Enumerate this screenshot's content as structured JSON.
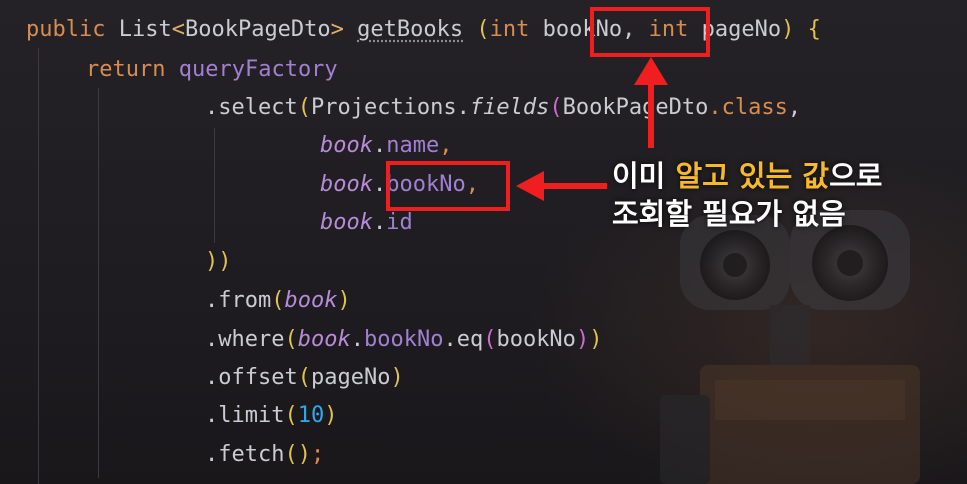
{
  "code": {
    "line1": {
      "kw_public": "public",
      "type_list": "List",
      "lt": "<",
      "generic": "BookPageDto",
      "gt": ">",
      "method": "getBooks",
      "open": "(",
      "int1": "int",
      "param1": "bookNo,",
      "int2": "int",
      "param2": "pageNo",
      "close": ")",
      "brace": "{"
    },
    "line2": {
      "kw_return": "return",
      "factory": "queryFactory"
    },
    "line3": {
      "select": ".select",
      "open1": "(",
      "projections": "Projections",
      "dot": ".",
      "fields": "fields",
      "open2": "(",
      "cls": "BookPageDto",
      "dotclass": ".class",
      "comma": ","
    },
    "line4": {
      "obj": "book",
      "dot": ".",
      "field": "name",
      "comma": ","
    },
    "line5": {
      "obj": "book",
      "dot": ".",
      "field": "bookNo",
      "comma": ","
    },
    "line6": {
      "obj": "book",
      "dot": ".",
      "field": "id"
    },
    "line7": {
      "close": "))"
    },
    "line8": {
      "call": ".from",
      "open": "(",
      "arg": "book",
      "close": ")"
    },
    "line9": {
      "call": ".where",
      "open1": "(",
      "obj": "book",
      "dot1": ".",
      "field": "bookNo",
      "dot2": ".",
      "eq": "eq",
      "open2": "(",
      "arg": "bookNo",
      "close2": ")",
      "close1": ")"
    },
    "line10": {
      "call": ".offset",
      "open": "(",
      "arg": "pageNo",
      "close": ")"
    },
    "line11": {
      "call": ".limit",
      "open": "(",
      "arg": "10",
      "close": ")"
    },
    "line12": {
      "call": ".fetch",
      "parens": "()",
      "semi": ";"
    }
  },
  "annotation": {
    "line1_part1": "이미 ",
    "line1_highlight": "알고 있는 값",
    "line1_part2": "으로",
    "line2": "조회할 필요가 없음"
  },
  "colors": {
    "highlight_box": "#f01e1e",
    "keyword": "#d98c4f",
    "annotation_accent": "#f5b92a"
  }
}
